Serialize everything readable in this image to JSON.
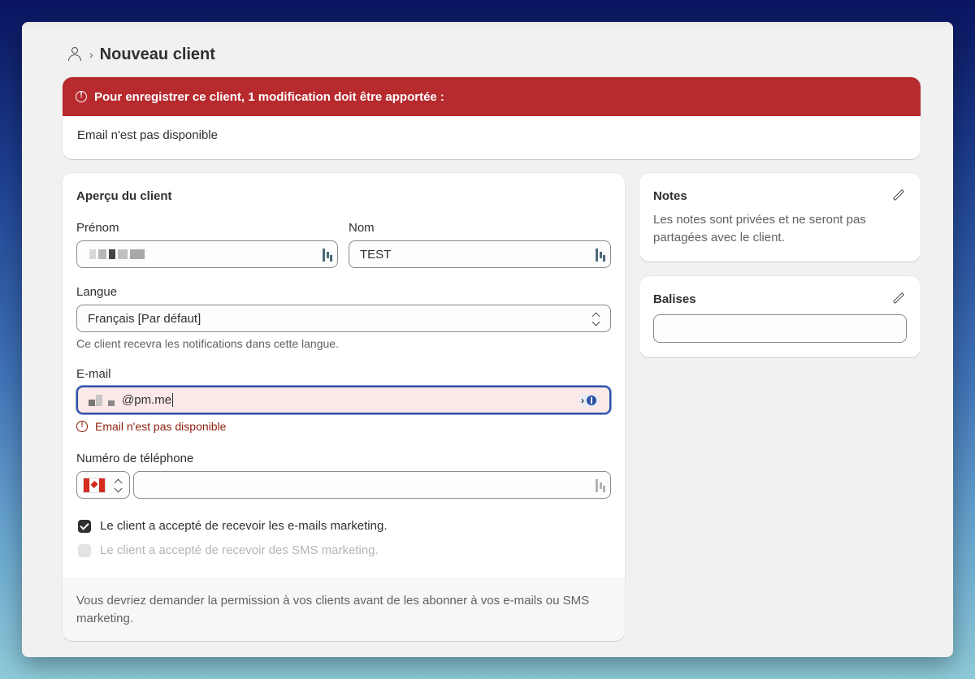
{
  "header": {
    "title": "Nouveau client",
    "separator": "›"
  },
  "alert": {
    "title": "Pour enregistrer ce client, 1 modification doit être apportée :",
    "message": "Email n'est pas disponible"
  },
  "overview": {
    "title": "Aperçu du client",
    "first_name_label": "Prénom",
    "first_name_value": "",
    "last_name_label": "Nom",
    "last_name_value": "TEST",
    "language_label": "Langue",
    "language_value": "Français [Par défaut]",
    "language_help": "Ce client recevra les notifications dans cette langue.",
    "email_label": "E-mail",
    "email_value": "@pm.me",
    "email_error": "Email n'est pas disponible",
    "phone_label": "Numéro de téléphone",
    "phone_value": "",
    "email_marketing_label": "Le client a accepté de recevoir les e-mails marketing.",
    "email_marketing_checked": true,
    "sms_marketing_label": "Le client a accepté de recevoir des SMS marketing.",
    "sms_marketing_checked": false,
    "footer": "Vous devriez demander la permission à vos clients avant de les abonner à vos e-mails ou SMS marketing."
  },
  "notes": {
    "title": "Notes",
    "text": "Les notes sont privées et ne seront pas partagées avec le client."
  },
  "tags": {
    "title": "Balises",
    "value": ""
  },
  "colors": {
    "alert": "#b72a2e",
    "error_text": "#8e1f0b",
    "focus": "#2c4fa3"
  }
}
